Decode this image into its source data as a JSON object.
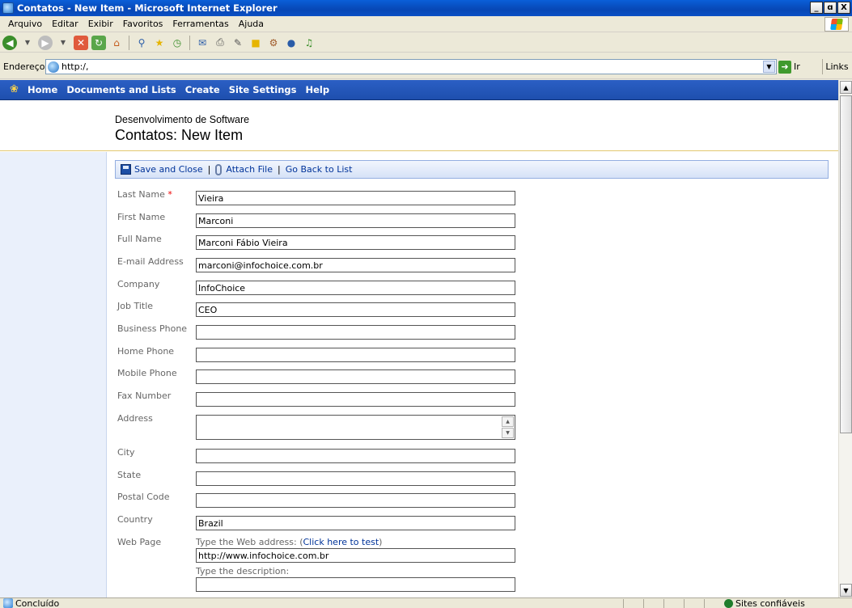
{
  "window": {
    "title": "Contatos - New Item - Microsoft Internet Explorer",
    "buttons": [
      "_",
      "ɑ",
      "X"
    ]
  },
  "menu": [
    "Arquivo",
    "Editar",
    "Exibir",
    "Favoritos",
    "Ferramentas",
    "Ajuda"
  ],
  "address": {
    "label": "Endereço",
    "value": "http:/,",
    "go_label": "Ir",
    "links_label": "Links"
  },
  "nav": [
    "Home",
    "Documents and Lists",
    "Create",
    "Site Settings",
    "Help"
  ],
  "header": {
    "site_name": "Desenvolvimento de Software",
    "page_title": "Contatos: New Item"
  },
  "actions": {
    "save": "Save and Close",
    "attach": "Attach File",
    "back": "Go Back to List",
    "separator": "|"
  },
  "form": {
    "required_mark": "*",
    "fields": {
      "last_name": {
        "label": "Last Name",
        "value": "Vieira"
      },
      "first_name": {
        "label": "First Name",
        "value": "Marconi"
      },
      "full_name": {
        "label": "Full Name",
        "value": "Marconi Fábio Vieira"
      },
      "email": {
        "label": "E-mail Address",
        "value": "marconi@infochoice.com.br"
      },
      "company": {
        "label": "Company",
        "value": "InfoChoice"
      },
      "job_title": {
        "label": "Job Title",
        "value": "CEO"
      },
      "business_phone": {
        "label": "Business Phone",
        "value": ""
      },
      "home_phone": {
        "label": "Home Phone",
        "value": ""
      },
      "mobile_phone": {
        "label": "Mobile Phone",
        "value": ""
      },
      "fax_number": {
        "label": "Fax Number",
        "value": ""
      },
      "address": {
        "label": "Address",
        "value": ""
      },
      "city": {
        "label": "City",
        "value": ""
      },
      "state": {
        "label": "State",
        "value": ""
      },
      "postal_code": {
        "label": "Postal Code",
        "value": ""
      },
      "country": {
        "label": "Country",
        "value": "Brazil"
      },
      "web_page": {
        "label": "Web Page",
        "hint_prefix": "Type the Web address: (",
        "hint_link": "Click here to test",
        "hint_suffix": ")",
        "value": "http://www.infochoice.com.br",
        "desc_hint": "Type the description:",
        "desc_value": ""
      }
    }
  },
  "status": {
    "text": "Concluído",
    "zone": "Sites confiáveis"
  }
}
